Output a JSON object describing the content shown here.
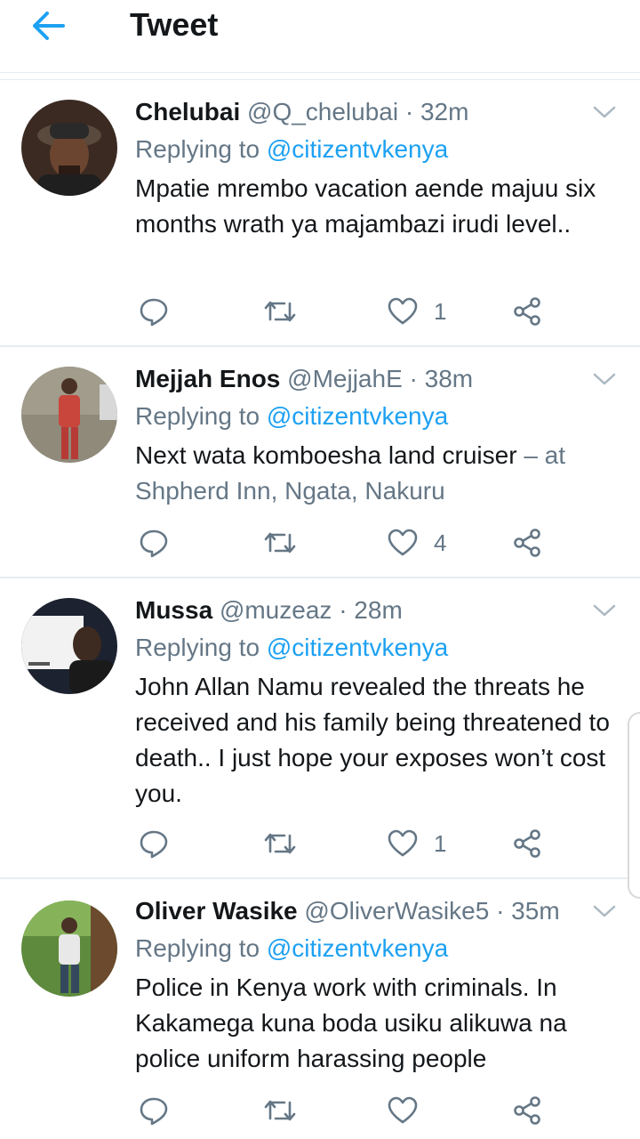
{
  "header": {
    "title": "Tweet",
    "back_icon": "arrow-left-icon",
    "accent": "#1da1f2"
  },
  "colors": {
    "primary_text": "#14171a",
    "secondary_text": "#657786",
    "link": "#1da1f2",
    "divider": "#e6ecf0"
  },
  "replying_label": "Replying to",
  "tweets": [
    {
      "name": "Chelubai",
      "handle": "@Q_chelubai",
      "separator": "·",
      "time": "32m",
      "reply_to": "@citizentvkenya",
      "text": "Mpatie mrembo vacation aende majuu six months wrath ya majambazi irudi level..",
      "location_text": "",
      "likes": "1"
    },
    {
      "name": "Mejjah Enos",
      "handle": "@MejjahE",
      "separator": "·",
      "time": "38m",
      "reply_to": "@citizentvkenya",
      "text": "Next wata komboesha land cruiser",
      "location_text": "– at Shpherd Inn, Ngata, Nakuru",
      "likes": "4"
    },
    {
      "name": "Mussa",
      "handle": "@muzeaz",
      "separator": "·",
      "time": "28m",
      "reply_to": "@citizentvkenya",
      "text": "John Allan Namu revealed the threats he received and his family being threatened to death.. I just hope your exposes won’t cost you.",
      "location_text": "",
      "likes": "1"
    },
    {
      "name": "Oliver Wasike",
      "handle": "@OliverWasike5",
      "separator": "·",
      "time": "35m",
      "reply_to": "@citizentvkenya",
      "text": "Police in Kenya work with criminals. In Kakamega kuna boda usiku alikuwa na police uniform harassing people",
      "location_text": "",
      "likes": ""
    }
  ],
  "action_icons": [
    "reply-icon",
    "retweet-icon",
    "like-icon",
    "share-icon"
  ]
}
